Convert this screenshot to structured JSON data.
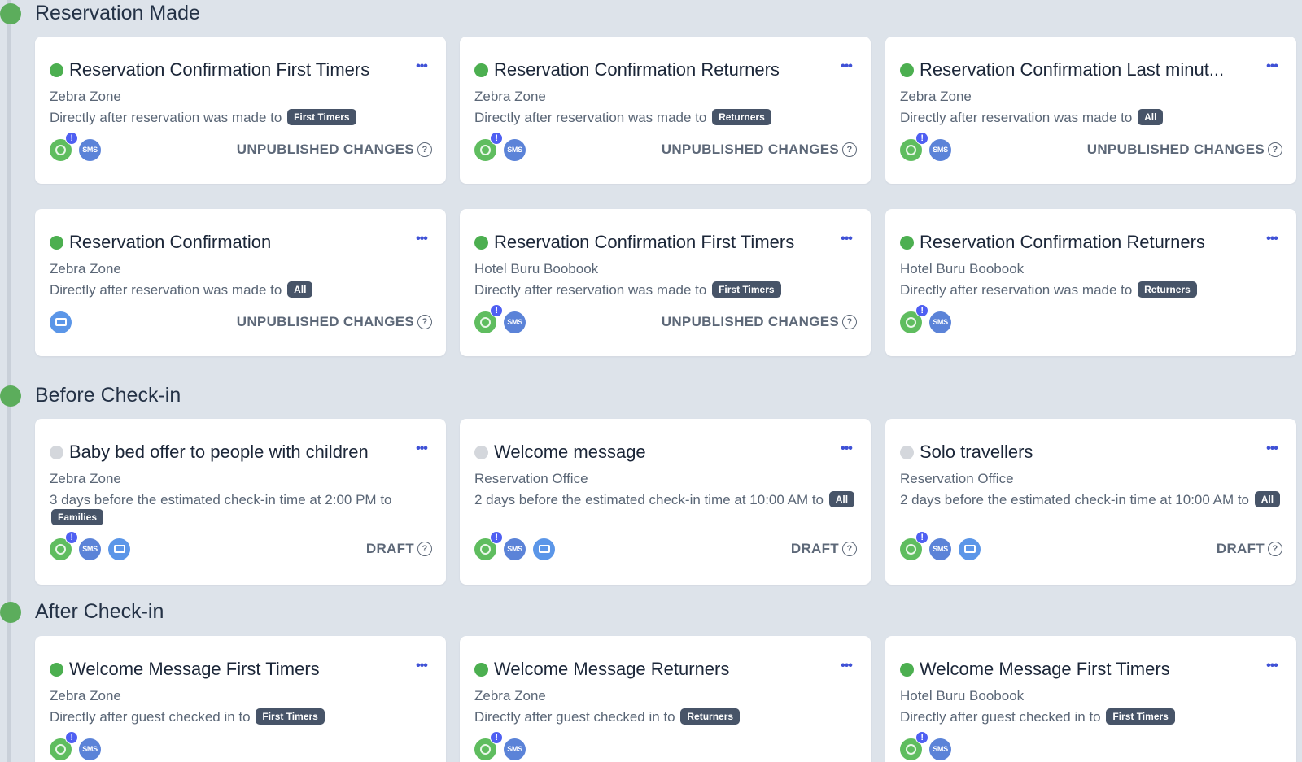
{
  "sections": [
    {
      "title": "Reservation Made",
      "cards": [
        {
          "title": "Reservation Confirmation First Timers",
          "location": "Zebra Zone",
          "trigger": "Directly after reservation was made to",
          "audience": "First Timers",
          "status": "UNPUBLISHED CHANGES",
          "state": "active",
          "channels": [
            "whatsapp",
            "sms"
          ]
        },
        {
          "title": "Reservation Confirmation Returners",
          "location": "Zebra Zone",
          "trigger": "Directly after reservation was made to",
          "audience": "Returners",
          "status": "UNPUBLISHED CHANGES",
          "state": "active",
          "channels": [
            "whatsapp",
            "sms"
          ]
        },
        {
          "title": "Reservation Confirmation Last minut...",
          "location": "Zebra Zone",
          "trigger": "Directly after reservation was made to",
          "audience": "All",
          "status": "UNPUBLISHED CHANGES",
          "state": "active",
          "channels": [
            "whatsapp",
            "sms"
          ]
        },
        {
          "title": "Reservation Confirmation",
          "location": "Zebra Zone",
          "trigger": "Directly after reservation was made to",
          "audience": "All",
          "status": "UNPUBLISHED CHANGES",
          "state": "active",
          "channels": [
            "email"
          ]
        },
        {
          "title": "Reservation Confirmation First Timers",
          "location": "Hotel Buru Boobook",
          "trigger": "Directly after reservation was made to",
          "audience": "First Timers",
          "status": "UNPUBLISHED CHANGES",
          "state": "active",
          "channels": [
            "whatsapp",
            "sms"
          ]
        },
        {
          "title": "Reservation Confirmation Returners",
          "location": "Hotel Buru Boobook",
          "trigger": "Directly after reservation was made to",
          "audience": "Returners",
          "status": "",
          "state": "active",
          "channels": [
            "whatsapp",
            "sms"
          ]
        }
      ]
    },
    {
      "title": "Before Check-in",
      "cards": [
        {
          "title": "Baby bed offer to people with children",
          "location": "Zebra Zone",
          "trigger": "3 days before the estimated check-in time at 2:00 PM to",
          "audience": "Families",
          "status": "DRAFT",
          "state": "draft",
          "channels": [
            "whatsapp",
            "sms",
            "email"
          ]
        },
        {
          "title": "Welcome message",
          "location": "Reservation Office",
          "trigger": "2 days before the estimated check-in time at 10:00 AM to",
          "audience": "All",
          "status": "DRAFT",
          "state": "draft",
          "channels": [
            "whatsapp",
            "sms",
            "email"
          ]
        },
        {
          "title": "Solo travellers",
          "location": "Reservation Office",
          "trigger": "2 days before the estimated check-in time at 10:00 AM to",
          "audience": "All",
          "status": "DRAFT",
          "state": "draft",
          "channels": [
            "whatsapp",
            "sms",
            "email"
          ]
        }
      ]
    },
    {
      "title": "After Check-in",
      "cards": [
        {
          "title": "Welcome Message First Timers",
          "location": "Zebra Zone",
          "trigger": "Directly after guest checked in to",
          "audience": "First Timers",
          "status": "",
          "state": "active",
          "channels": [
            "whatsapp",
            "sms"
          ]
        },
        {
          "title": "Welcome Message Returners",
          "location": "Zebra Zone",
          "trigger": "Directly after guest checked in to",
          "audience": "Returners",
          "status": "",
          "state": "active",
          "channels": [
            "whatsapp",
            "sms"
          ]
        },
        {
          "title": "Welcome Message First Timers",
          "location": "Hotel Buru Boobook",
          "trigger": "Directly after guest checked in to",
          "audience": "First Timers",
          "status": "",
          "state": "active",
          "channels": [
            "whatsapp",
            "sms"
          ]
        }
      ]
    }
  ],
  "ui": {
    "sms_label": "SMS",
    "alert_mark": "!",
    "help_mark": "?",
    "more_label": "•••"
  },
  "colors": {
    "background": "#dde3ea",
    "active_dot": "#4caf50",
    "draft_dot": "#d4d7dc",
    "badge": "#475468",
    "accent": "#4f5ff2"
  }
}
